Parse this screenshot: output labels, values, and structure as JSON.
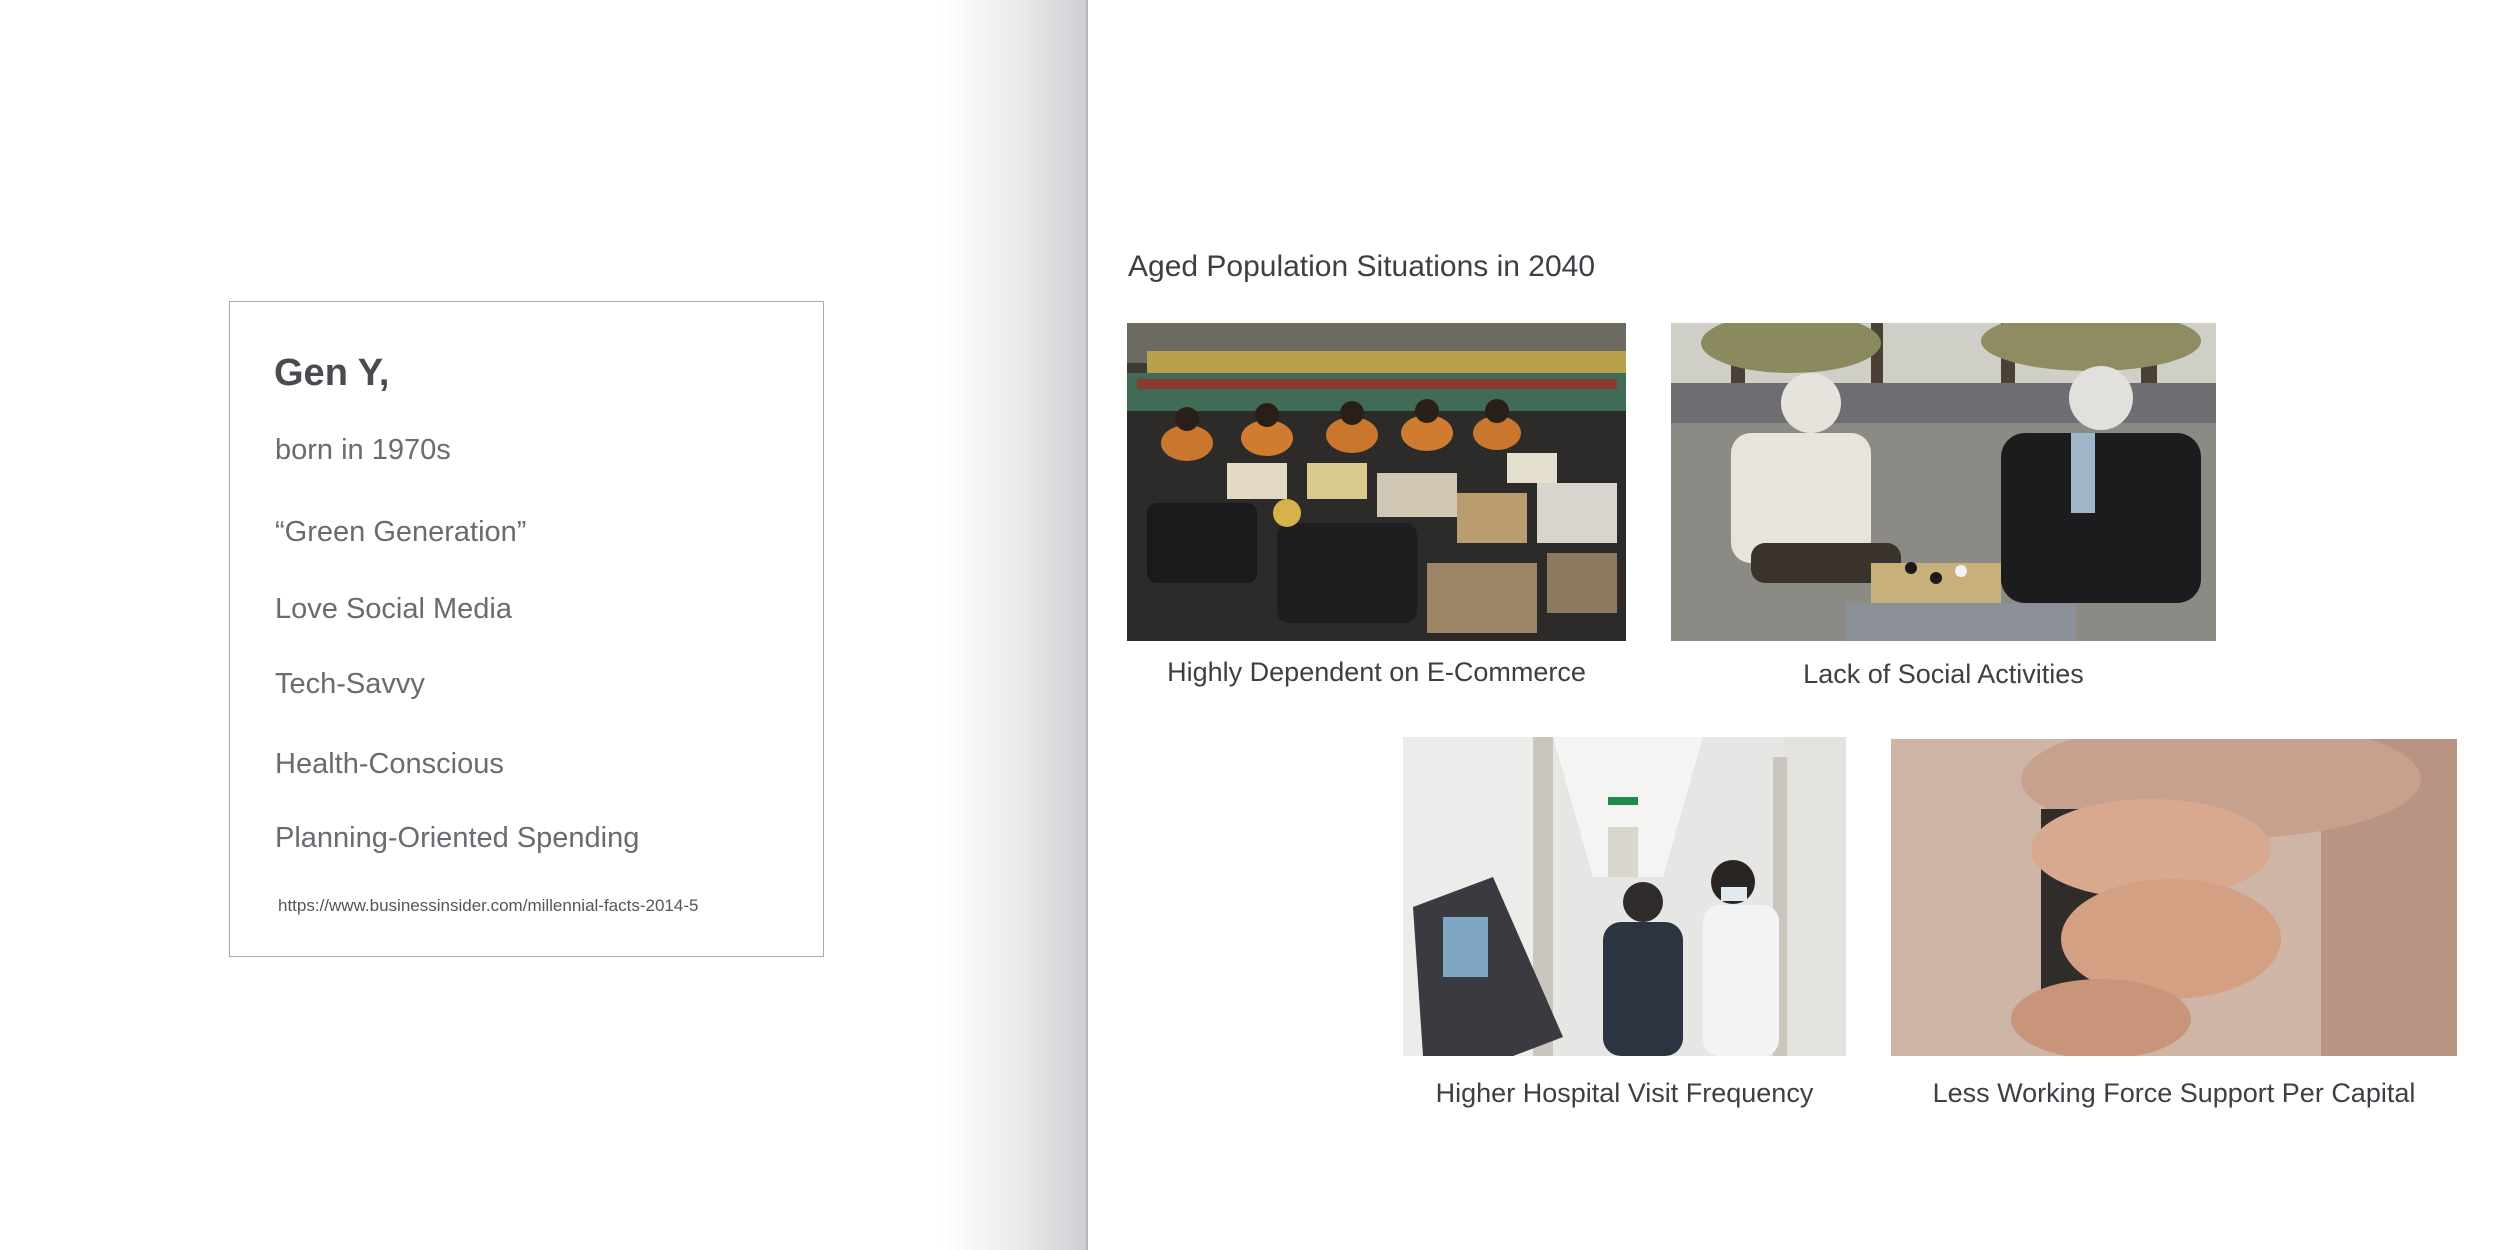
{
  "left_page": {
    "card": {
      "title": "Gen Y,",
      "traits": [
        "born in 1970s",
        "“Green Generation”",
        "Love Social Media",
        "Tech-Savvy",
        "Health-Conscious",
        "Planning-Oriented Spending"
      ],
      "source_url": "https://www.businessinsider.com/millennial-facts-2014-5"
    }
  },
  "right_page": {
    "title": "Aged Population Situations in 2040",
    "figures": [
      {
        "caption": "Highly Dependent on E-Commerce"
      },
      {
        "caption": "Lack of Social Activities"
      },
      {
        "caption": "Higher Hospital Visit Frequency"
      },
      {
        "caption": "Less Working Force Support Per Capital"
      }
    ]
  },
  "colors": {
    "text_dark": "#3e3e44",
    "text_muted": "#6a6a70",
    "card_border": "#a9a9ad",
    "gutter_shadow": "#cfcfd2"
  }
}
